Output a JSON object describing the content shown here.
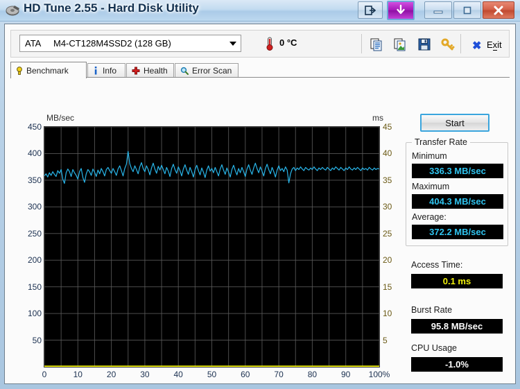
{
  "window": {
    "title": "HD Tune 2.55 - Hard Disk Utility",
    "icon": "hdtune-disk-icon",
    "buttons": {
      "restore_export": "export-icon",
      "download": "download-arrow-icon",
      "minimize": "minimize-icon",
      "maximize": "maximize-icon",
      "close": "close-icon"
    }
  },
  "toolbar": {
    "drive": {
      "bus": "ATA",
      "model": "M4-CT128M4SSD2 (128 GB)"
    },
    "temperature": "0 °C",
    "temperature_icon": "thermometer-icon",
    "icons": [
      {
        "name": "copy-text-icon"
      },
      {
        "name": "copy-image-icon"
      },
      {
        "name": "save-icon"
      },
      {
        "name": "key-icon"
      }
    ],
    "exit_label": "Exit",
    "exit_accel": "x"
  },
  "tabs": [
    {
      "label": "Benchmark",
      "icon": "bulb-icon",
      "active": true
    },
    {
      "label": "Info",
      "icon": "info-icon",
      "active": false
    },
    {
      "label": "Health",
      "icon": "health-cross-icon",
      "active": false
    },
    {
      "label": "Error Scan",
      "icon": "magnifier-icon",
      "active": false
    }
  ],
  "results": {
    "start_label": "Start",
    "transfer_rate": {
      "legend": "Transfer Rate",
      "minimum_label": "Minimum",
      "minimum_value": "336.3 MB/sec",
      "maximum_label": "Maximum",
      "maximum_value": "404.3 MB/sec",
      "average_label": "Average:",
      "average_value": "372.2 MB/sec"
    },
    "access_time_label": "Access Time:",
    "access_time_value": "0.1 ms",
    "burst_rate_label": "Burst Rate",
    "burst_rate_value": "95.8 MB/sec",
    "cpu_usage_label": "CPU Usage",
    "cpu_usage_value": "-1.0%"
  },
  "colors": {
    "transfer_curve": "#29b6ea",
    "access_curve": "#f2f20c",
    "plot_bg": "#000000",
    "grid": "#5a5a5a",
    "value_cyan": "#2fc4f0",
    "value_yellow": "#f2f20c"
  },
  "chart_data": {
    "type": "line",
    "title": "",
    "xlabel": "",
    "ylabel": "MB/sec",
    "y2label": "ms",
    "xlim": [
      0,
      100
    ],
    "ylim": [
      0,
      450
    ],
    "y2lim": [
      0,
      45
    ],
    "grid": true,
    "xticks": [
      "0",
      "10",
      "20",
      "30",
      "40",
      "50",
      "60",
      "70",
      "80",
      "90",
      "100%"
    ],
    "xtick_values": [
      0,
      10,
      20,
      30,
      40,
      50,
      60,
      70,
      80,
      90,
      100
    ],
    "yticks": [
      450,
      400,
      350,
      300,
      250,
      200,
      150,
      100,
      50
    ],
    "y2ticks": [
      45,
      40,
      35,
      30,
      25,
      20,
      15,
      10,
      5
    ],
    "series": [
      {
        "name": "Transfer rate",
        "axis": "left",
        "color": "#29b6ea",
        "x": [
          0.0,
          0.5,
          1.0,
          1.5,
          2.0,
          2.5,
          3.0,
          3.5,
          4.0,
          4.5,
          5.0,
          5.5,
          6.0,
          6.5,
          7.0,
          7.5,
          8.0,
          8.5,
          9.0,
          9.5,
          10.0,
          10.5,
          11.0,
          11.5,
          12.0,
          12.5,
          13.0,
          13.5,
          14.0,
          14.5,
          15.0,
          15.5,
          16.0,
          16.5,
          17.0,
          17.5,
          18.0,
          18.5,
          19.0,
          19.5,
          20.0,
          20.5,
          21.0,
          21.5,
          22.0,
          22.5,
          23.0,
          23.5,
          24.0,
          24.5,
          25.0,
          25.5,
          26.0,
          26.5,
          27.0,
          27.5,
          28.0,
          28.5,
          29.0,
          29.5,
          30.0,
          30.5,
          31.0,
          31.5,
          32.0,
          32.5,
          33.0,
          33.5,
          34.0,
          34.5,
          35.0,
          35.5,
          36.0,
          36.5,
          37.0,
          37.5,
          38.0,
          38.5,
          39.0,
          39.5,
          40.0,
          40.5,
          41.0,
          41.5,
          42.0,
          42.5,
          43.0,
          43.5,
          44.0,
          44.5,
          45.0,
          45.5,
          46.0,
          46.5,
          47.0,
          47.5,
          48.0,
          48.5,
          49.0,
          49.5,
          50.0,
          50.5,
          51.0,
          51.5,
          52.0,
          52.5,
          53.0,
          53.5,
          54.0,
          54.5,
          55.0,
          55.5,
          56.0,
          56.5,
          57.0,
          57.5,
          58.0,
          58.5,
          59.0,
          59.5,
          60.0,
          60.5,
          61.0,
          61.5,
          62.0,
          62.5,
          63.0,
          63.5,
          64.0,
          64.5,
          65.0,
          65.5,
          66.0,
          66.5,
          67.0,
          67.5,
          68.0,
          68.5,
          69.0,
          69.5,
          70.0,
          70.5,
          71.0,
          71.5,
          72.0,
          72.5,
          73.0,
          73.5,
          74.0,
          74.5,
          75.0,
          75.5,
          76.0,
          76.5,
          77.0,
          77.5,
          78.0,
          78.5,
          79.0,
          79.5,
          80.0,
          80.5,
          81.0,
          81.5,
          82.0,
          82.5,
          83.0,
          83.5,
          84.0,
          84.5,
          85.0,
          85.5,
          86.0,
          86.5,
          87.0,
          87.5,
          88.0,
          88.5,
          89.0,
          89.5,
          90.0,
          90.5,
          91.0,
          91.5,
          92.0,
          92.5,
          93.0,
          93.5,
          94.0,
          94.5,
          95.0,
          95.5,
          96.0,
          96.5,
          97.0,
          97.5,
          98.0,
          98.5,
          99.0,
          99.5,
          100.0
        ],
        "y": [
          358,
          362,
          356,
          364,
          359,
          366,
          361,
          357,
          368,
          363,
          370,
          352,
          344,
          364,
          371,
          366,
          357,
          370,
          364,
          359,
          352,
          366,
          372,
          355,
          346,
          362,
          370,
          366,
          359,
          371,
          365,
          357,
          369,
          362,
          372,
          366,
          358,
          370,
          374,
          368,
          363,
          372,
          366,
          359,
          371,
          377,
          368,
          358,
          372,
          380,
          404,
          381,
          372,
          366,
          377,
          370,
          362,
          375,
          383,
          372,
          366,
          377,
          370,
          360,
          373,
          382,
          371,
          363,
          376,
          369,
          378,
          370,
          362,
          374,
          367,
          357,
          372,
          380,
          370,
          363,
          375,
          368,
          358,
          371,
          379,
          369,
          361,
          374,
          366,
          356,
          370,
          378,
          368,
          360,
          373,
          365,
          355,
          369,
          377,
          367,
          372,
          364,
          374,
          366,
          358,
          371,
          379,
          369,
          361,
          373,
          365,
          356,
          370,
          378,
          368,
          360,
          372,
          364,
          374,
          366,
          357,
          371,
          379,
          369,
          361,
          373,
          382,
          372,
          364,
          375,
          367,
          358,
          372,
          380,
          370,
          362,
          374,
          366,
          356,
          369,
          377,
          368,
          372,
          366,
          375,
          369,
          345,
          362,
          371,
          374,
          368,
          373,
          370,
          375,
          371,
          368,
          374,
          371,
          369,
          373,
          370,
          375,
          371,
          368,
          373,
          370,
          374,
          371,
          369,
          374,
          371,
          368,
          373,
          370,
          375,
          372,
          369,
          374,
          371,
          368,
          373,
          370,
          375,
          371,
          369,
          373,
          370,
          374,
          371,
          368,
          373,
          370,
          372,
          369,
          374,
          371,
          369,
          373,
          370,
          372,
          371
        ]
      },
      {
        "name": "Access time",
        "axis": "right",
        "color": "#f2f20c",
        "x": [
          0,
          5,
          10,
          15,
          20,
          25,
          30,
          35,
          40,
          45,
          50,
          55,
          60,
          65,
          70,
          75,
          80,
          85,
          90,
          95,
          100
        ],
        "y": [
          0.1,
          0.1,
          0.1,
          0.1,
          0.1,
          0.1,
          0.1,
          0.1,
          0.1,
          0.1,
          0.1,
          0.1,
          0.1,
          0.1,
          0.1,
          0.1,
          0.1,
          0.1,
          0.1,
          0.1,
          0.1
        ]
      }
    ]
  }
}
